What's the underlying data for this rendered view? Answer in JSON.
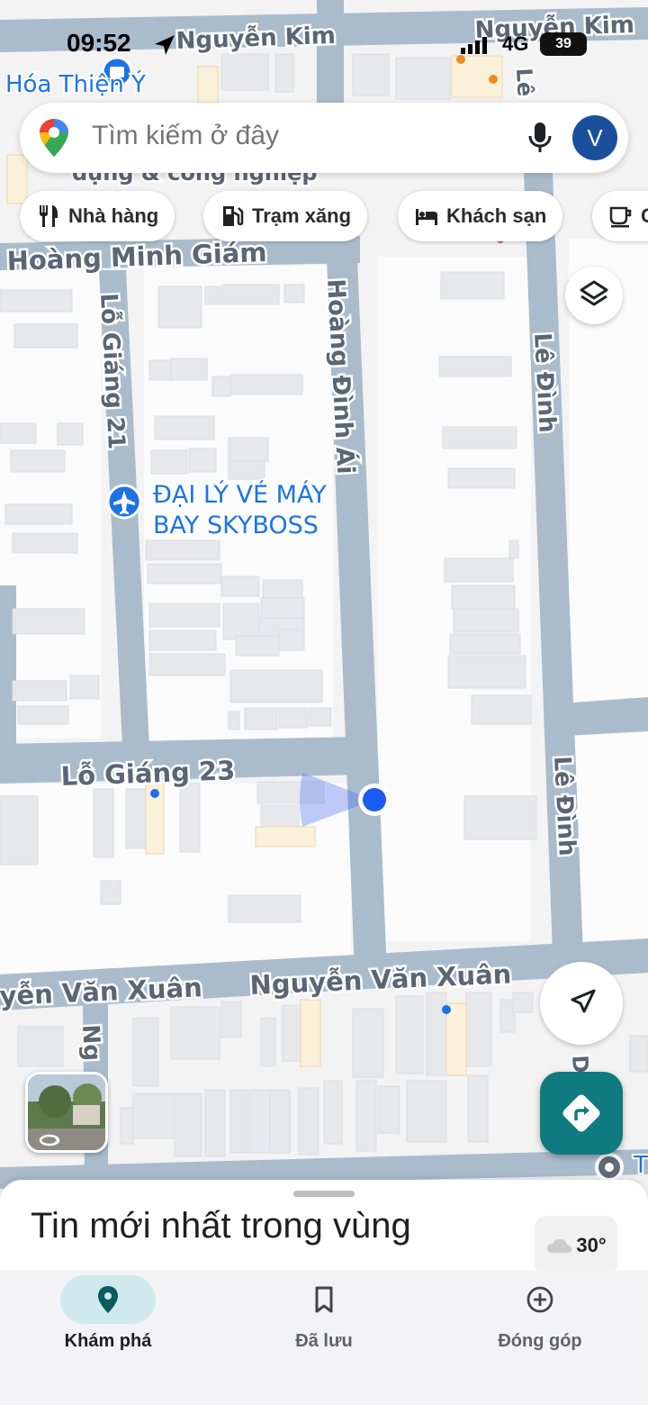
{
  "status_bar": {
    "time": "09:52",
    "network": "4G",
    "battery": "39"
  },
  "search": {
    "placeholder": "Tìm kiếm ở đây",
    "avatar_letter": "V"
  },
  "chips": [
    {
      "label": "Nhà hàng",
      "icon": "restaurant-icon"
    },
    {
      "label": "Trạm xăng",
      "icon": "gas-station-icon"
    },
    {
      "label": "Khách sạn",
      "icon": "hotel-icon"
    },
    {
      "label": "C",
      "icon": "coffee-icon"
    }
  ],
  "map": {
    "streets": {
      "nguyen_kim_1": "Nguyễn Kim",
      "nguyen_kim_2": "Nguyễn Kim",
      "hoang_minh_giam": "Hoàng Minh Giám",
      "lo_giang_21": "Lỗ Giáng 21",
      "hoang_dinh_ai": "Hoàng Đình Ái",
      "le_dinh_1": "Lê Đình",
      "le_dinh_2": "Lê Đình",
      "le_top": "Lê",
      "lo_giang_23": "Lỗ Giáng 23",
      "nguyen_van_xuan_1": "yễn Văn Xuân",
      "nguyen_van_xuan_2": "Nguyễn Văn Xuân",
      "nguyen_vert": "Ng",
      "bottom_partial": "D",
      "behind_search": "dụng & công nghiệp"
    },
    "pois": {
      "top_left": "Hóa Thiện Ý",
      "agency_line1": "ĐẠI LÝ VÉ MÁY",
      "agency_line2": "BAY SKYBOSS",
      "right_edge": "T"
    }
  },
  "sheet": {
    "title": "Tin mới nhất trong vùng",
    "temperature": "30°"
  },
  "nav": [
    {
      "label": "Khám phá",
      "icon": "explore-pin-icon",
      "active": true
    },
    {
      "label": "Đã lưu",
      "icon": "bookmark-icon",
      "active": false
    },
    {
      "label": "Đóng góp",
      "icon": "add-circle-icon",
      "active": false
    }
  ],
  "colors": {
    "accent": "#0f7a80",
    "road": "#aabccc",
    "block": "#ffffff",
    "building": "#e6e8ec",
    "user_dot": "#1a73e8"
  }
}
